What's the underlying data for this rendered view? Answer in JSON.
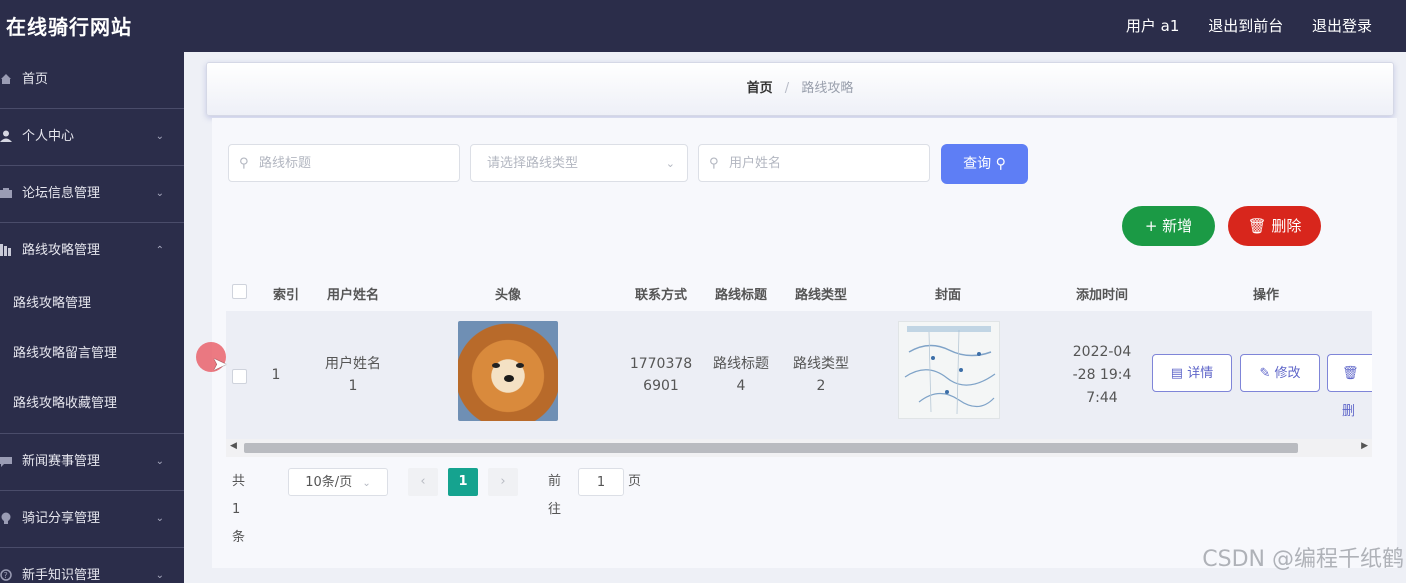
{
  "header": {
    "title": "在线骑行网站",
    "user_label": "用户 a1",
    "back_label": "退出到前台",
    "logout_label": "退出登录"
  },
  "sidebar": {
    "items": [
      {
        "label": "首页",
        "icon": "home-icon"
      },
      {
        "label": "个人中心",
        "icon": "user-icon"
      },
      {
        "label": "论坛信息管理",
        "icon": "forum-icon"
      },
      {
        "label": "路线攻略管理",
        "icon": "route-icon"
      }
    ],
    "sub_items": [
      "路线攻略管理",
      "路线攻略留言管理",
      "路线攻略收藏管理"
    ],
    "items_after": [
      {
        "label": "新闻赛事管理",
        "icon": "news-icon"
      },
      {
        "label": "骑记分享管理",
        "icon": "bulb-icon"
      },
      {
        "label": "新手知识管理",
        "icon": "help-icon"
      }
    ]
  },
  "breadcrumb": {
    "home": "首页",
    "separator": "/",
    "current": "路线攻略"
  },
  "search": {
    "title_placeholder": "路线标题",
    "type_placeholder": "请选择路线类型",
    "user_placeholder": "用户姓名",
    "query_label": "查询"
  },
  "actions": {
    "add_label": "新增",
    "delete_label": "删除"
  },
  "table": {
    "headers": [
      "索引",
      "用户姓名",
      "头像",
      "联系方式",
      "路线标题",
      "路线类型",
      "封面",
      "添加时间",
      "操作"
    ],
    "rows": [
      {
        "index": "1",
        "username_1": "用户姓名",
        "username_2": "1",
        "phone_1": "1770378",
        "phone_2": "6901",
        "route_title_1": "路线标题",
        "route_title_2": "4",
        "route_type_1": "路线类型",
        "route_type_2": "2",
        "time_1": "2022-04",
        "time_2": "-28 19:4",
        "time_3": "7:44",
        "detail_label": "详情",
        "edit_label": "修改",
        "delete_label": "删"
      }
    ]
  },
  "pagination": {
    "total_label": "共 1 条",
    "page_size": "10条/页",
    "current_page": "1",
    "goto_label": "前往",
    "goto_value": "1",
    "page_unit": "页"
  },
  "watermark": "CSDN @编程千纸鹤",
  "colors": {
    "sidebar_bg": "#2b2d4a",
    "query_btn": "#5e7ef5",
    "add_btn": "#1b9a45",
    "delete_btn": "#d8261c",
    "active_page": "#15a38f"
  }
}
